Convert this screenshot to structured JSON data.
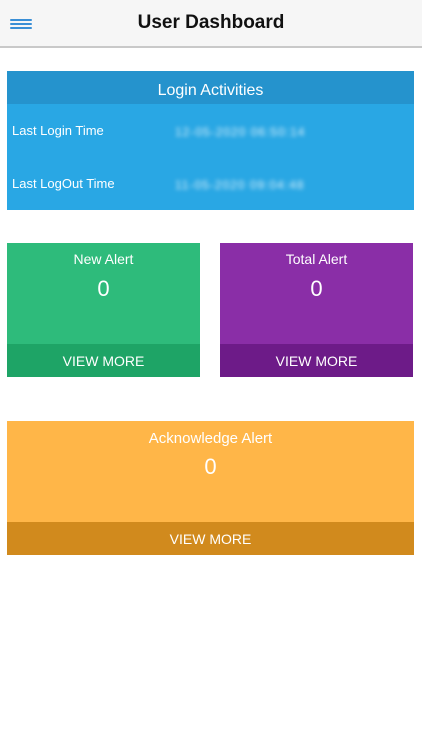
{
  "header": {
    "title": "User Dashboard",
    "menu_icon": "hamburger-menu-icon"
  },
  "login_activities": {
    "title": "Login Activities",
    "last_login_label": "Last Login Time",
    "last_login_value": "12-05-2020 06:50:14",
    "last_logout_label": "Last LogOut Time",
    "last_logout_value": "11-05-2020 09:04:48"
  },
  "cards": {
    "new_alert": {
      "title": "New Alert",
      "count": "0",
      "action": "VIEW MORE"
    },
    "total_alert": {
      "title": "Total Alert",
      "count": "0",
      "action": "VIEW MORE"
    },
    "acknowledge_alert": {
      "title": "Acknowledge Alert",
      "count": "0",
      "action": "VIEW MORE"
    }
  },
  "colors": {
    "login_card": "#29a7e4",
    "new_alert": "#2ebb7b",
    "total_alert": "#8a2ea7",
    "acknowledge_alert": "#ffb648"
  }
}
